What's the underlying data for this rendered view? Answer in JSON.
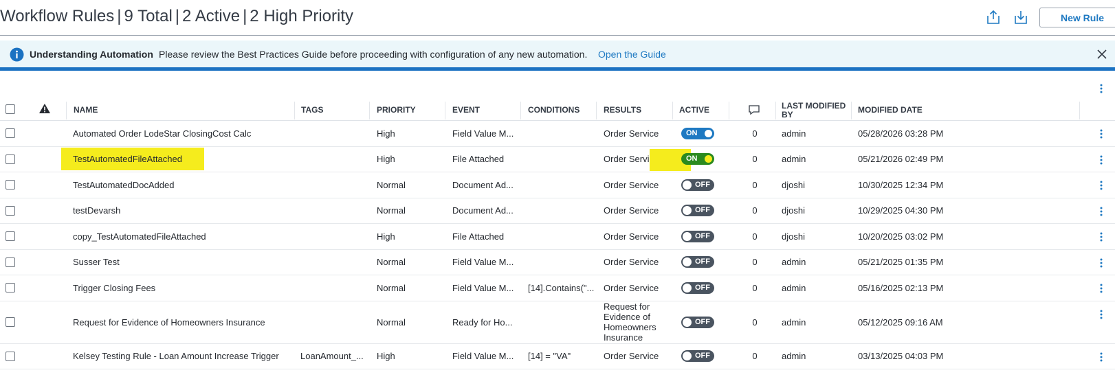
{
  "header": {
    "title": "Workflow Rules",
    "total": "9 Total",
    "active": "2 Active",
    "high_priority": "2 High Priority",
    "new_rule_label": "New Rule",
    "export_icon": "export-icon",
    "import_icon": "import-icon"
  },
  "banner": {
    "title": "Understanding Automation",
    "message": "Please review the Best Practices Guide before proceeding with configuration of any new automation.",
    "link": "Open the Guide"
  },
  "table": {
    "columns": {
      "name": "NAME",
      "tags": "TAGS",
      "priority": "PRIORITY",
      "event": "EVENT",
      "conditions": "CONDITIONS",
      "results": "RESULTS",
      "active": "ACTIVE",
      "last_modified_by": "LAST MODIFIED BY",
      "modified_date": "MODIFIED DATE"
    },
    "rows": [
      {
        "name": "Automated Order LodeStar ClosingCost Calc",
        "tags": "",
        "priority": "High",
        "event": "Field Value M...",
        "conditions": "",
        "results": "Order Service",
        "active": "ON",
        "comments": "0",
        "by": "admin",
        "date": "05/28/2026 03:28 PM"
      },
      {
        "name": "TestAutomatedFileAttached",
        "tags": "",
        "priority": "High",
        "event": "File Attached",
        "conditions": "",
        "results": "Order Service",
        "active": "ON",
        "comments": "0",
        "by": "admin",
        "date": "05/21/2026 02:49 PM"
      },
      {
        "name": "TestAutomatedDocAdded",
        "tags": "",
        "priority": "Normal",
        "event": "Document Ad...",
        "conditions": "",
        "results": "Order Service",
        "active": "OFF",
        "comments": "0",
        "by": "djoshi",
        "date": "10/30/2025 12:34 PM"
      },
      {
        "name": "testDevarsh",
        "tags": "",
        "priority": "Normal",
        "event": "Document Ad...",
        "conditions": "",
        "results": "Order Service",
        "active": "OFF",
        "comments": "0",
        "by": "djoshi",
        "date": "10/29/2025 04:30 PM"
      },
      {
        "name": "copy_TestAutomatedFileAttached",
        "tags": "",
        "priority": "High",
        "event": "File Attached",
        "conditions": "",
        "results": "Order Service",
        "active": "OFF",
        "comments": "0",
        "by": "djoshi",
        "date": "10/20/2025 03:02 PM"
      },
      {
        "name": "Susser Test",
        "tags": "",
        "priority": "Normal",
        "event": "Field Value M...",
        "conditions": "",
        "results": "Order Service",
        "active": "OFF",
        "comments": "0",
        "by": "admin",
        "date": "05/21/2025 01:35 PM"
      },
      {
        "name": "Trigger Closing Fees",
        "tags": "",
        "priority": "Normal",
        "event": "Field Value M...",
        "conditions": "[14].Contains(\"...",
        "results": "Order Service",
        "active": "OFF",
        "comments": "0",
        "by": "admin",
        "date": "05/16/2025 02:13 PM"
      },
      {
        "name": "Request for Evidence of Homeowners Insurance",
        "tags": "",
        "priority": "Normal",
        "event": "Ready for Ho...",
        "conditions": "",
        "results": "Request for Evidence of Homeowners Insurance",
        "active": "OFF",
        "comments": "0",
        "by": "admin",
        "date": "05/12/2025 09:16 AM"
      },
      {
        "name": "Kelsey Testing Rule - Loan Amount Increase Trigger",
        "tags": "LoanAmount_...",
        "priority": "High",
        "event": "Field Value M...",
        "conditions": "[14] = \"VA\"",
        "results": "Order Service",
        "active": "OFF",
        "comments": "0",
        "by": "admin",
        "date": "03/13/2025 04:03 PM"
      }
    ]
  }
}
